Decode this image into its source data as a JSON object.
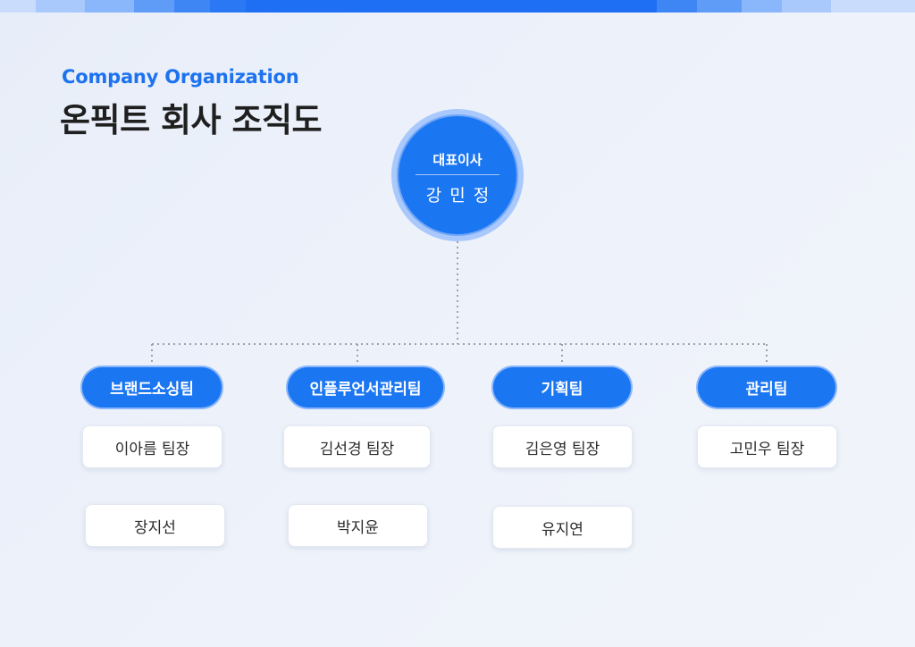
{
  "header": {
    "subtitle": "Company Organization",
    "title": "온픽트 회사 조직도"
  },
  "ceo": {
    "role": "대표이사",
    "name": "강민정"
  },
  "teams": [
    {
      "name": "브랜드소싱팀",
      "members": [
        "이아름 팀장",
        "장지선"
      ]
    },
    {
      "name": "인플루언서관리팀",
      "members": [
        "김선경 팀장",
        "박지윤"
      ]
    },
    {
      "name": "기획팀",
      "members": [
        "김은영 팀장",
        "유지연"
      ]
    },
    {
      "name": "관리팀",
      "members": [
        "고민우 팀장"
      ]
    }
  ],
  "colors": {
    "accent": "#1b76f2",
    "title_text": "#1f1f1f",
    "card_background": "#ffffff"
  }
}
